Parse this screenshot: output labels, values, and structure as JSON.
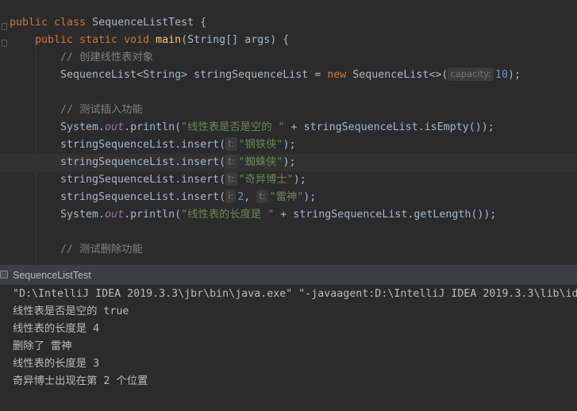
{
  "editor": {
    "class_decl": {
      "kw": "public class ",
      "name": "SequenceListTest",
      "tail": " {"
    },
    "main_decl": {
      "kw": "public static void ",
      "name": "main",
      "params": "(String[] args) {"
    },
    "comment_create": "// 创建线性表对象",
    "create_line": {
      "left": "SequenceList<String> stringSequenceList = ",
      "kw": "new",
      "ctor": " SequenceList<>(",
      "hint": "capacity:",
      "num": "10",
      "tail": ");"
    },
    "comment_insert": "// 测试插入功能",
    "println_empty": {
      "obj": "System.",
      "field": "out",
      "call": ".println(",
      "str": "\"线性表是否是空的 \"",
      "tail": " + stringSequenceList.isEmpty());"
    },
    "insert1": {
      "call": "stringSequenceList.insert(",
      "hint": "t:",
      "str": "\"钢铁侠\"",
      "tail": ");"
    },
    "insert2": {
      "call": "stringSequenceList.insert(",
      "hint": "t:",
      "str": "\"蜘蛛侠\"",
      "tail": ");"
    },
    "insert3": {
      "call": "stringSequenceList.insert(",
      "hint": "t:",
      "str": "\"奇异博士\"",
      "tail": ");"
    },
    "insert4": {
      "call": "stringSequenceList.insert(",
      "hint_i": "i:",
      "num": "2",
      "sep": ", ",
      "hint_t": "t:",
      "str": "\"雷神\"",
      "tail": ");"
    },
    "println_length": {
      "obj": "System.",
      "field": "out",
      "call": ".println(",
      "str": "\"线性表的长度是 \"",
      "tail": " + stringSequenceList.getLength());"
    },
    "comment_delete": "// 测试删除功能"
  },
  "run_panel": {
    "tab_title": "SequenceListTest",
    "output": [
      "\"D:\\IntelliJ IDEA 2019.3.3\\jbr\\bin\\java.exe\" \"-javaagent:D:\\IntelliJ IDEA 2019.3.3\\lib\\id",
      "线性表是否是空的 true",
      "线性表的长度是 4",
      "删除了 雷神",
      "线性表的长度是 3",
      "奇异博士出现在第 2 个位置"
    ]
  },
  "colors": {
    "background": "#2b2b2b",
    "keyword": "#cc7832",
    "method": "#ffc66d",
    "string": "#6a8759",
    "number": "#6897bb",
    "comment": "#808080",
    "static_field": "#9876aa"
  }
}
